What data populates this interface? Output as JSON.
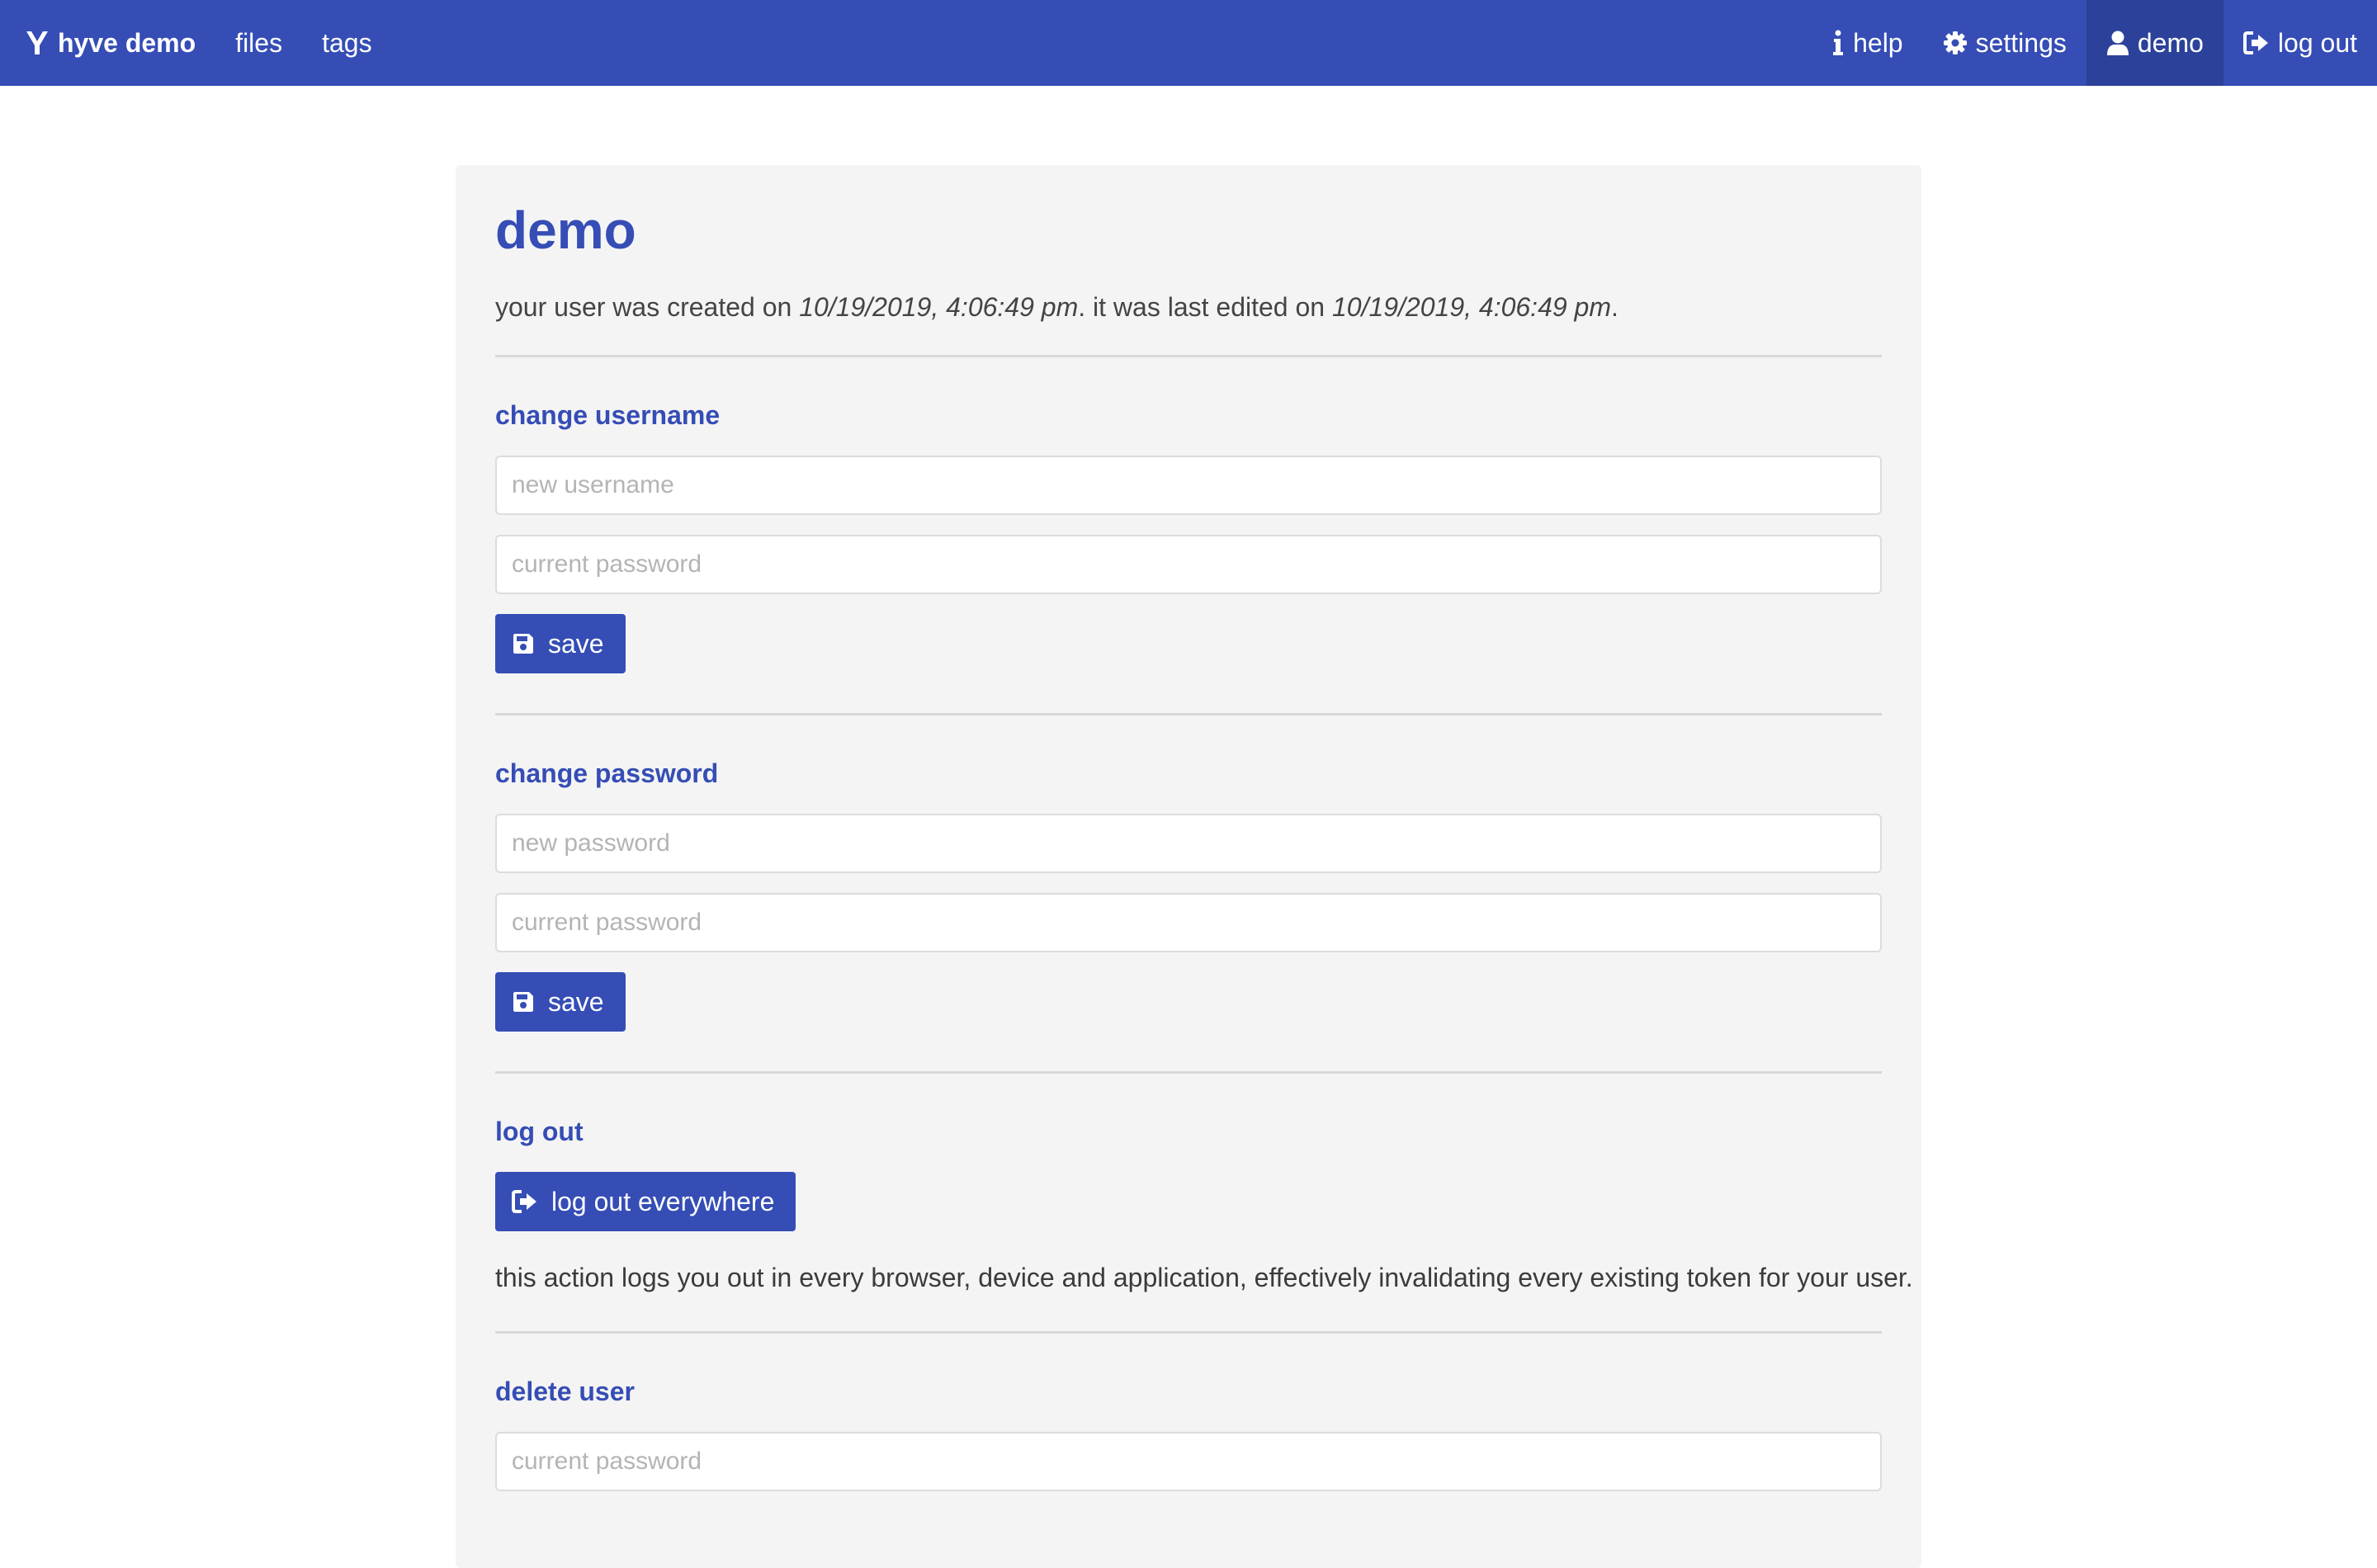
{
  "navbar": {
    "brand": "hyve demo",
    "left_items": [
      {
        "label": "files"
      },
      {
        "label": "tags"
      }
    ],
    "right_items": [
      {
        "label": "help",
        "icon": "info-icon"
      },
      {
        "label": "settings",
        "icon": "gear-icon"
      },
      {
        "label": "demo",
        "icon": "user-icon",
        "active": true
      },
      {
        "label": "log out",
        "icon": "sign-out-icon"
      }
    ]
  },
  "page": {
    "title": "demo",
    "meta": {
      "prefix": "your user was created on ",
      "created": "10/19/2019, 4:06:49 pm",
      "middle": ". it was last edited on ",
      "edited": "10/19/2019, 4:06:49 pm",
      "suffix": "."
    }
  },
  "change_username": {
    "title": "change username",
    "new_username_placeholder": "new username",
    "current_password_placeholder": "current password",
    "save_label": "save"
  },
  "change_password": {
    "title": "change password",
    "new_password_placeholder": "new password",
    "current_password_placeholder": "current password",
    "save_label": "save"
  },
  "log_out": {
    "title": "log out",
    "button_label": "log out everywhere",
    "description": "this action logs you out in every browser, device and application, effectively invalidating every existing token for your user."
  },
  "delete_user": {
    "title": "delete user",
    "current_password_placeholder": "current password"
  },
  "colors": {
    "primary": "#354db5",
    "navbar_active": "#2c4199",
    "card_bg": "#f4f4f4"
  }
}
